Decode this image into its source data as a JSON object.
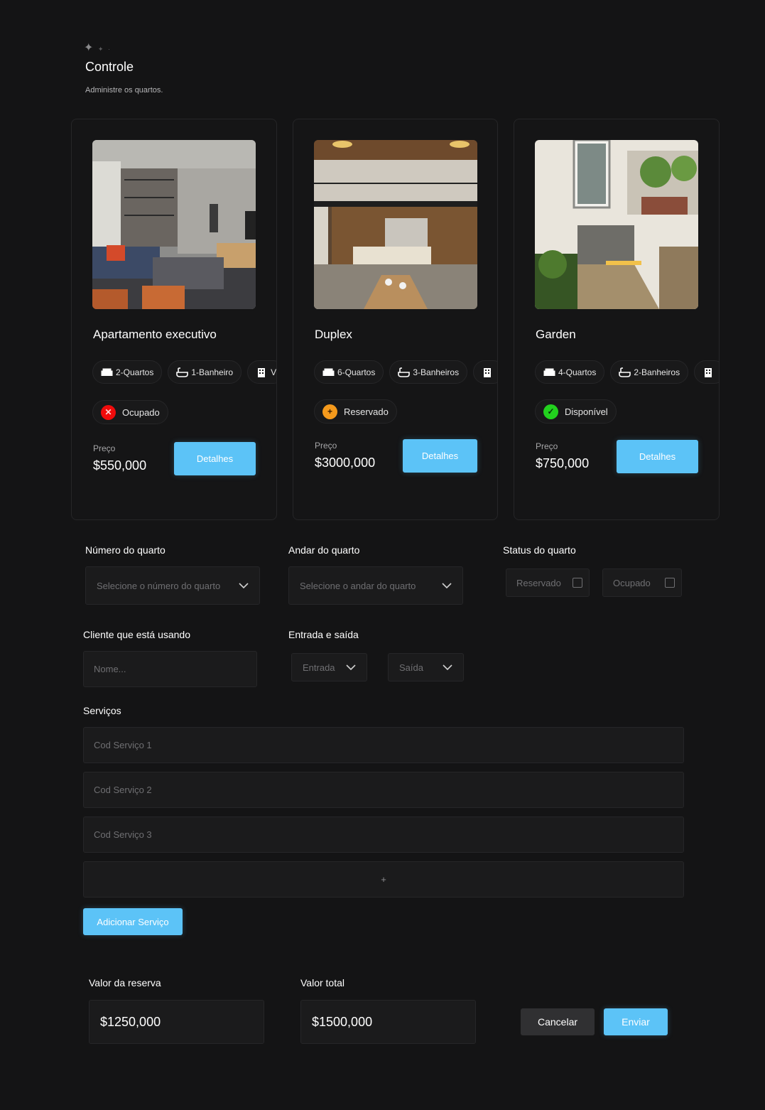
{
  "header": {
    "title": "Controle",
    "subtitle": "Administre os quartos."
  },
  "rooms": [
    {
      "name": "Apartamento executivo",
      "chips": [
        "2-Quartos",
        "1-Banheiro",
        "V"
      ],
      "status": "Ocupado",
      "status_color": "#f00b0b",
      "price_label": "Preço",
      "price": "$550,000",
      "button": "Detalhes"
    },
    {
      "name": "Duplex",
      "chips": [
        "6-Quartos",
        "3-Banheiros",
        ""
      ],
      "status": "Reservado",
      "status_color": "#f59a1c",
      "price_label": "Preço",
      "price": "$3000,000",
      "button": "Detalhes"
    },
    {
      "name": "Garden",
      "chips": [
        "4-Quartos",
        "2-Banheiros",
        ""
      ],
      "status": "Disponível",
      "status_color": "#22d11e",
      "price_label": "Preço",
      "price": "$750,000",
      "button": "Detalhes"
    }
  ],
  "form": {
    "room_number_label": "Número do quarto",
    "room_number_placeholder": "Selecione o número do quarto",
    "floor_label": "Andar do quarto",
    "floor_placeholder": "Selecione o andar do quarto",
    "status_label": "Status do quarto",
    "status_options": [
      "Reservado",
      "Ocupado"
    ],
    "client_label": "Cliente que está usando",
    "client_placeholder": "Nome...",
    "dates_label": "Entrada e saída",
    "entry_placeholder": "Entrada",
    "exit_placeholder": "Saída",
    "services_label": "Serviços",
    "services": [
      "Cod Serviço 1",
      "Cod Serviço 2",
      "Cod Serviço 3"
    ],
    "add_plus": "+",
    "add_service_button": "Adicionar Serviço"
  },
  "totals": {
    "reservation_label": "Valor da reserva",
    "reservation_value": "$1250,000",
    "total_label": "Valor total",
    "total_value": "$1500,000",
    "cancel_button": "Cancelar",
    "submit_button": "Enviar"
  },
  "colors": {
    "accent": "#5cc3f7",
    "background": "#141415",
    "surface": "#1b1b1c"
  }
}
